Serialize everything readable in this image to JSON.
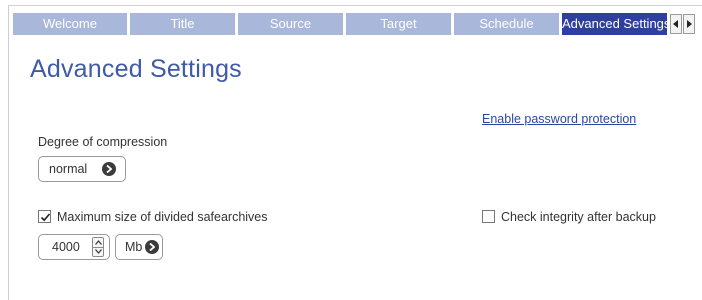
{
  "tabs": [
    {
      "label": "Welcome",
      "active": false
    },
    {
      "label": "Title",
      "active": false
    },
    {
      "label": "Source",
      "active": false
    },
    {
      "label": "Target",
      "active": false
    },
    {
      "label": "Schedule",
      "active": false
    },
    {
      "label": "Advanced Settings",
      "active": true
    }
  ],
  "page_title": "Advanced Settings",
  "password_link": "Enable password protection",
  "compression": {
    "label": "Degree of compression",
    "value": "normal"
  },
  "max_size": {
    "checkbox_label": "Maximum size of divided safearchives",
    "checked": true,
    "value": "4000",
    "unit": "Mb"
  },
  "integrity": {
    "checkbox_label": "Check integrity after backup",
    "checked": false
  },
  "colors": {
    "tab_inactive": "#a9b7db",
    "tab_active": "#2f3f9e",
    "title": "#3f5aa6",
    "link": "#2c46a0"
  }
}
